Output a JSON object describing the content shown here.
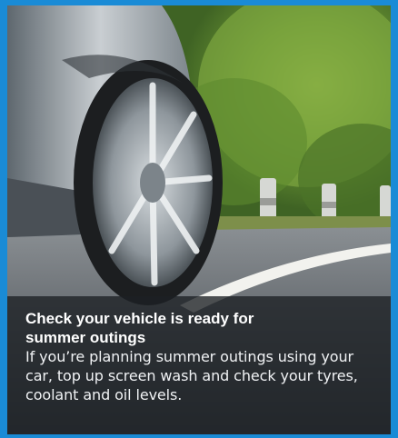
{
  "card": {
    "title": "Check your vehicle is ready for summer outings",
    "body": "If you’re planning summer outings using your car, top up screen wash and check your tyres, coolant and oil levels.",
    "image_subject": "car-wheel-on-road-photo"
  },
  "colors": {
    "frame": "#1a8bd6",
    "caption_background": "#1c2024",
    "caption_text": "#ffffff"
  }
}
